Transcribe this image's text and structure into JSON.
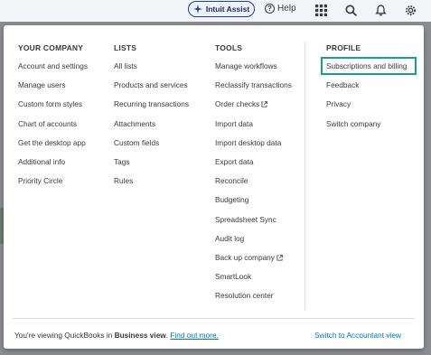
{
  "header": {
    "assist_label": "Intuit Assist",
    "help_label": "Help",
    "icons": [
      "apps-grid-icon",
      "search-icon",
      "bell-icon",
      "gear-icon"
    ]
  },
  "menu": {
    "your_company": {
      "title": "YOUR COMPANY",
      "items": [
        "Account and settings",
        "Manage users",
        "Custom form styles",
        "Chart of accounts",
        "Get the desktop app",
        "Additional info",
        "Priority Circle"
      ]
    },
    "lists": {
      "title": "LISTS",
      "items": [
        "All lists",
        "Products and services",
        "Recurring transactions",
        "Attachments",
        "Custom fields",
        "Tags",
        "Rules"
      ]
    },
    "tools": {
      "title": "TOOLS",
      "items": [
        "Manage workflows",
        "Reclassify transactions",
        "Order checks",
        "Import data",
        "Import desktop data",
        "Export data",
        "Reconcile",
        "Budgeting",
        "Spreadsheet Sync",
        "Audit log",
        "Back up company",
        "SmartLook",
        "Resolution center"
      ]
    },
    "profile": {
      "title": "PROFILE",
      "items": [
        "Subscriptions and billing",
        "Feedback",
        "Privacy",
        "Switch company"
      ],
      "highlighted": "Subscriptions and billing"
    }
  },
  "footer": {
    "text_prefix": "You're viewing QuickBooks in ",
    "view_name": "Business view",
    "text_suffix": ". ",
    "link": "Find out more.",
    "switch_label": "Switch to Accountant view"
  },
  "colors": {
    "link": "#0077c5",
    "highlight_border": "#16a085",
    "assist_border": "#1b3f9c"
  }
}
